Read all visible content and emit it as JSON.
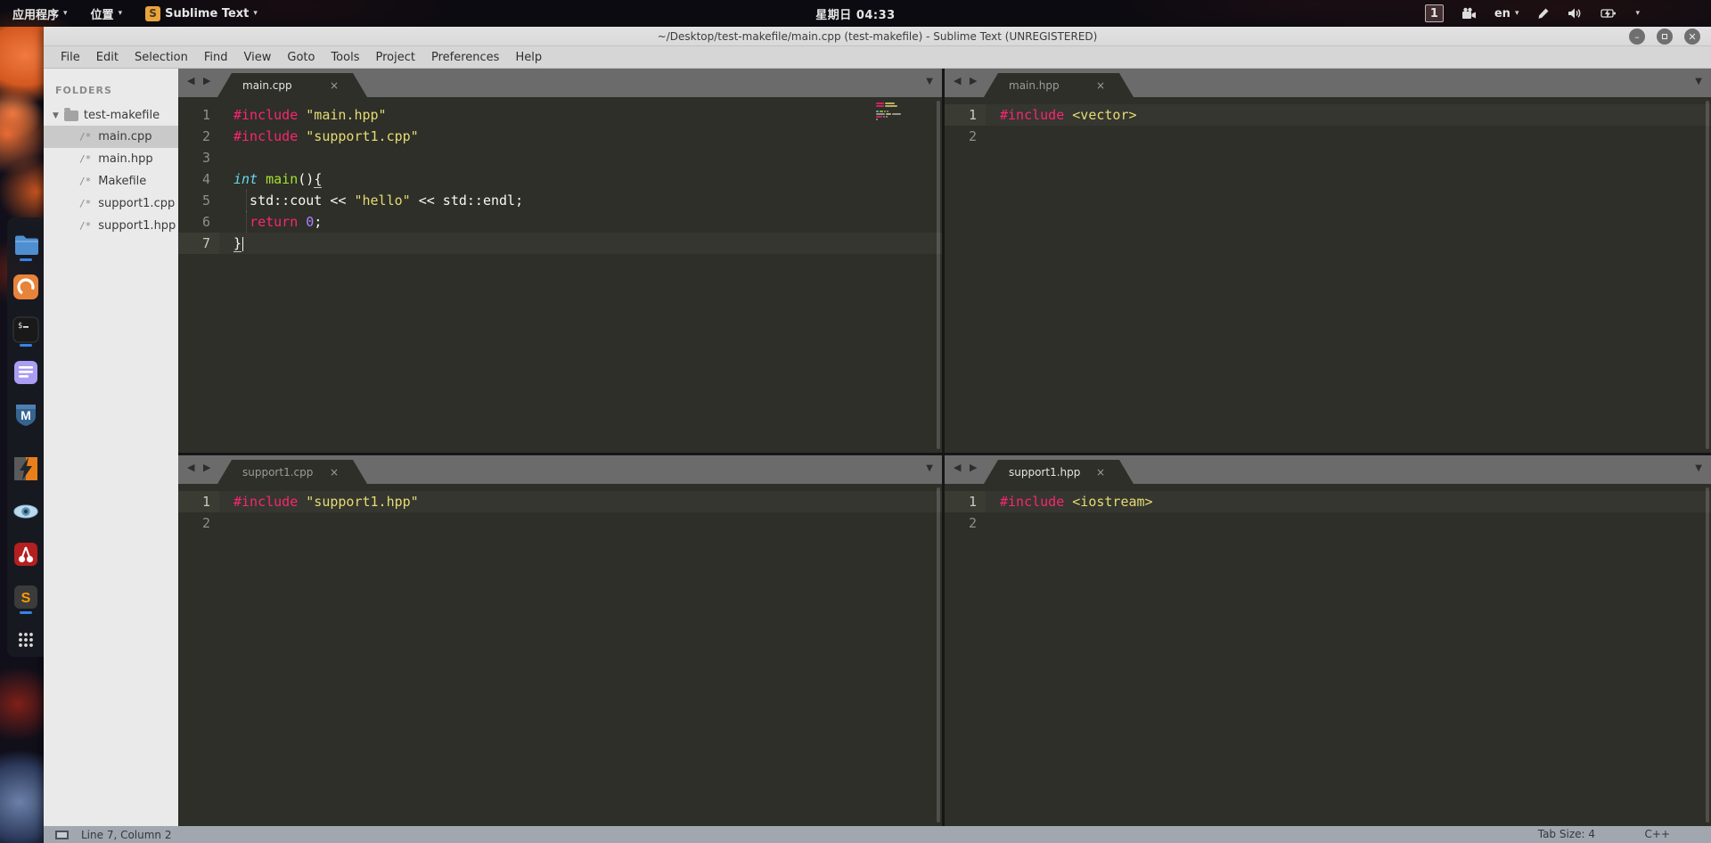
{
  "topbar": {
    "applications": "应用程序",
    "places": "位置",
    "app_name": "Sublime Text",
    "app_badge": "S",
    "clock": "星期日 04:33",
    "workspace": "1",
    "keyboard_layout": "en"
  },
  "window": {
    "title": "~/Desktop/test-makefile/main.cpp (test-makefile) - Sublime Text (UNREGISTERED)",
    "menus": [
      "File",
      "Edit",
      "Selection",
      "Find",
      "View",
      "Goto",
      "Tools",
      "Project",
      "Preferences",
      "Help"
    ]
  },
  "sidebar": {
    "heading": "FOLDERS",
    "root": "test-makefile",
    "file_icon_glyph": "/*",
    "files": [
      "main.cpp",
      "main.hpp",
      "Makefile",
      "support1.cpp",
      "support1.hpp"
    ],
    "selected": "main.cpp"
  },
  "panes": [
    {
      "tab": "main.cpp",
      "tab_active": true,
      "active_line": 7,
      "cursor_line": 7,
      "minimap": true,
      "guide_lines": [
        5,
        6
      ],
      "lines": [
        [
          [
            "#include",
            "pink"
          ],
          [
            " ",
            "plain"
          ],
          [
            "\"main.hpp\"",
            "str"
          ]
        ],
        [
          [
            "#include",
            "pink"
          ],
          [
            " ",
            "plain"
          ],
          [
            "\"support1.cpp\"",
            "str"
          ]
        ],
        [],
        [
          [
            "int",
            "type"
          ],
          [
            " ",
            "plain"
          ],
          [
            "main",
            "func"
          ],
          [
            "()",
            "plain"
          ],
          [
            "{",
            "plain",
            "u"
          ]
        ],
        [
          [
            "  std::cout << ",
            "plain"
          ],
          [
            "\"hello\"",
            "str"
          ],
          [
            " << std::endl;",
            "plain"
          ]
        ],
        [
          [
            "  ",
            "plain"
          ],
          [
            "return",
            "pink"
          ],
          [
            " ",
            "plain"
          ],
          [
            "0",
            "num"
          ],
          [
            ";",
            "plain"
          ]
        ],
        [
          [
            "}",
            "plain",
            "u"
          ]
        ]
      ]
    },
    {
      "tab": "main.hpp",
      "tab_active": false,
      "active_line": 1,
      "lines": [
        [
          [
            "#include",
            "pink"
          ],
          [
            " ",
            "plain"
          ],
          [
            "<vector>",
            "str"
          ]
        ],
        []
      ]
    },
    {
      "tab": "support1.cpp",
      "tab_active": false,
      "active_line": 1,
      "lines": [
        [
          [
            "#include",
            "pink"
          ],
          [
            " ",
            "plain"
          ],
          [
            "\"support1.hpp\"",
            "str"
          ]
        ],
        []
      ]
    },
    {
      "tab": "support1.hpp",
      "tab_active": true,
      "active_line": 1,
      "lines": [
        [
          [
            "#include",
            "pink"
          ],
          [
            " ",
            "plain"
          ],
          [
            "<iostream>",
            "str"
          ]
        ],
        []
      ]
    }
  ],
  "statusbar": {
    "position": "Line 7, Column 2",
    "tab_size": "Tab Size: 4",
    "syntax": "C++"
  },
  "dock": [
    {
      "name": "files",
      "running": true
    },
    {
      "name": "firefox",
      "running": false
    },
    {
      "name": "terminal",
      "running": true
    },
    {
      "name": "text-editor",
      "running": false
    },
    {
      "name": "metasploit",
      "running": false
    },
    {
      "name": "lightning-tool",
      "running": false
    },
    {
      "name": "eye-tool",
      "running": false
    },
    {
      "name": "cherrytree",
      "running": false
    },
    {
      "name": "sublime-text",
      "running": true
    },
    {
      "name": "show-applications",
      "running": false
    }
  ],
  "colors": {
    "syntax_pink": "#f92672",
    "syntax_string": "#e6db74",
    "syntax_type": "#66d9ef",
    "syntax_func": "#a6e22e",
    "syntax_num": "#ae81ff",
    "syntax_plain": "#f8f8f2",
    "editor_bg": "#2e2f28",
    "accent_blue": "#3584e4",
    "sublime_orange": "#ff9800"
  }
}
